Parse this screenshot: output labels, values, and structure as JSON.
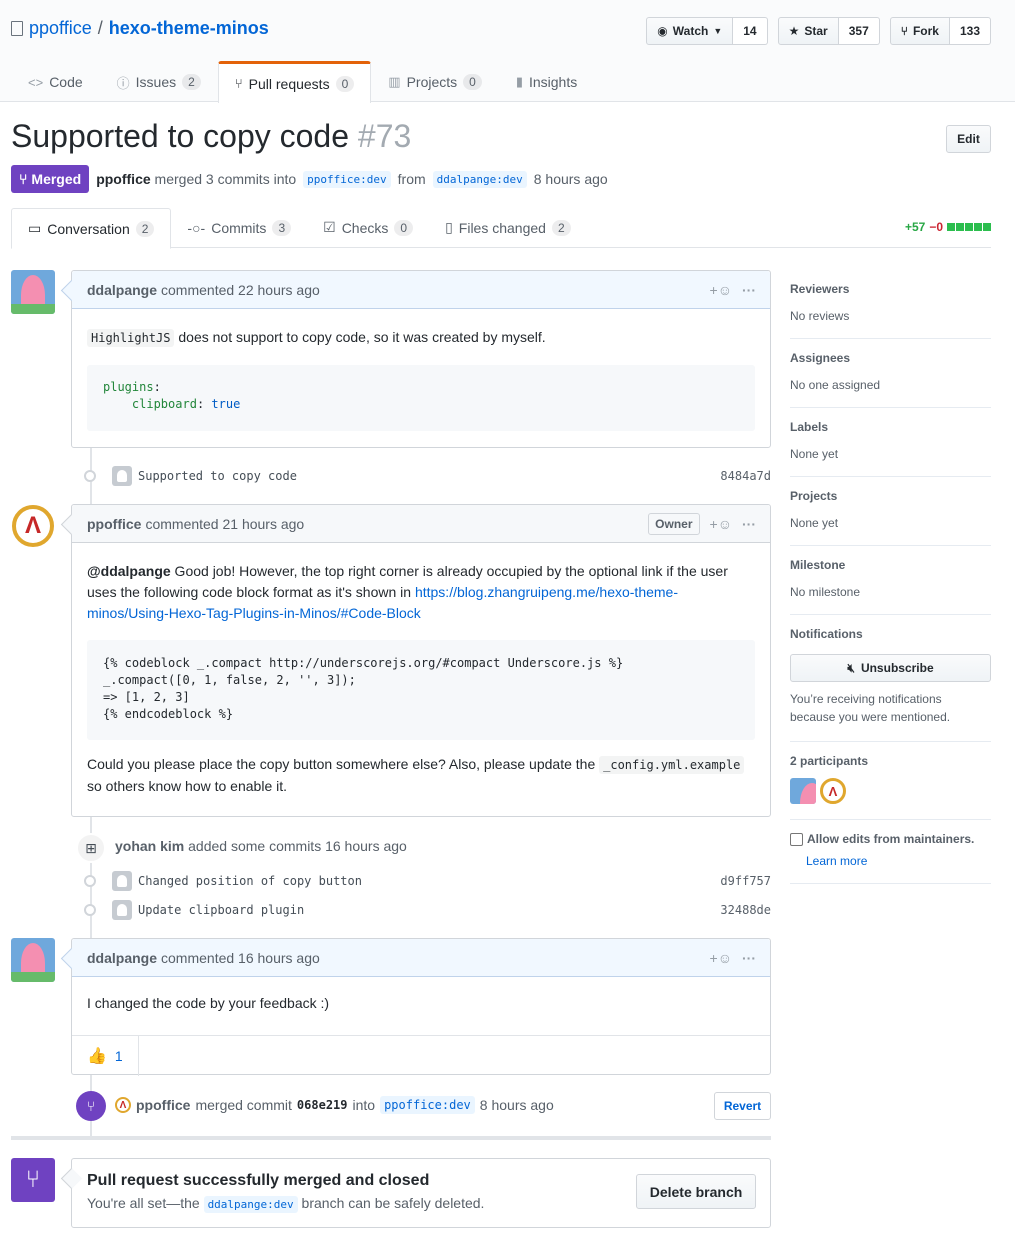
{
  "repo": {
    "owner": "ppoffice",
    "separator": "/",
    "name": "hexo-theme-minos"
  },
  "actions": [
    {
      "label": "Watch",
      "count": "14",
      "icon": "eye-icon"
    },
    {
      "label": "Star",
      "count": "357",
      "icon": "star-icon"
    },
    {
      "label": "Fork",
      "count": "133",
      "icon": "fork-icon"
    }
  ],
  "tabs": [
    {
      "label": "Code",
      "count": ""
    },
    {
      "label": "Issues",
      "count": "2"
    },
    {
      "label": "Pull requests",
      "count": "0"
    },
    {
      "label": "Projects",
      "count": "0"
    },
    {
      "label": "Insights",
      "count": ""
    }
  ],
  "pr": {
    "title": "Supported to copy code",
    "number": "#73",
    "edit_label": "Edit",
    "state": "Merged",
    "author": "ppoffice",
    "merged_text": "merged 3 commits into",
    "base": "ppoffice:dev",
    "from": "from",
    "head": "ddalpange:dev",
    "time": "8 hours ago"
  },
  "prtabs": [
    {
      "label": "Conversation",
      "count": "2"
    },
    {
      "label": "Commits",
      "count": "3"
    },
    {
      "label": "Checks",
      "count": "0"
    },
    {
      "label": "Files changed",
      "count": "2"
    }
  ],
  "diffstat": {
    "additions": "+57",
    "deletions": "−0"
  },
  "comment1": {
    "author": "ddalpange",
    "meta": "commented 22 hours ago",
    "code_inline": "HighlightJS",
    "text": " does not support to copy code, so it was created by myself.",
    "code_line1_key": "plugins",
    "code_line2_key": "clipboard",
    "code_line2_val": "true"
  },
  "commit1": {
    "message": "Supported to copy code",
    "sha": "8484a7d"
  },
  "comment2": {
    "author": "ppoffice",
    "meta": "commented 21 hours ago",
    "owner_label": "Owner",
    "mention": "@ddalpange",
    "text1a": " Good job! However, the top right corner is already occupied by the optional link if the user",
    "text1b": "uses the following code block format as it's shown in ",
    "link1": "https://blog.zhangruipeng.me/hexo-theme-",
    "link2": "minos/Using-Hexo-Tag-Plugins-in-Minos/#Code-Block",
    "code": "{% codeblock _.compact http://underscorejs.org/#compact Underscore.js %}\n_.compact([0, 1, false, 2, '', 3]);\n=> [1, 2, 3]\n{% endcodeblock %}",
    "text2": "Could you please place the copy button somewhere else? Also, please update the ",
    "text2_code": "_config.yml.example",
    "text3": "so others know how to enable it."
  },
  "event_commits": {
    "author": "yohan kim",
    "text": "added some commits 16 hours ago"
  },
  "commit2": {
    "message": "Changed position of copy button",
    "sha": "d9ff757"
  },
  "commit3": {
    "message": "Update clipboard plugin",
    "sha": "32488de"
  },
  "comment3": {
    "author": "ddalpange",
    "meta": "commented 16 hours ago",
    "text": "I changed the code by your feedback :)",
    "reaction_count": "1"
  },
  "merge_event": {
    "author": "ppoffice",
    "text": "merged commit",
    "sha": "068e219",
    "into": "into",
    "base": "ppoffice:dev",
    "time": "8 hours ago",
    "revert_label": "Revert"
  },
  "merged_box": {
    "title": "Pull request successfully merged and closed",
    "text_before": "You're all set—the ",
    "branch": "ddalpange:dev",
    "text_after": " branch can be safely deleted.",
    "button": "Delete branch"
  },
  "sidebar": {
    "reviewers": {
      "heading": "Reviewers",
      "value": "No reviews"
    },
    "assignees": {
      "heading": "Assignees",
      "value": "No one assigned"
    },
    "labels": {
      "heading": "Labels",
      "value": "None yet"
    },
    "projects": {
      "heading": "Projects",
      "value": "None yet"
    },
    "milestone": {
      "heading": "Milestone",
      "value": "No milestone"
    },
    "notifications": {
      "heading": "Notifications",
      "button": "Unsubscribe",
      "reason1": "You’re receiving notifications",
      "reason2": "because you were mentioned."
    },
    "participants": {
      "heading": "2 participants"
    },
    "maintainers": {
      "label": "Allow edits from maintainers.",
      "link": "Learn more"
    }
  },
  "colors": {
    "merged": "#6f42c1",
    "accent": "#0366d6",
    "tab_active": "#e36209",
    "add": "#28a745",
    "delete": "#cb2431"
  }
}
